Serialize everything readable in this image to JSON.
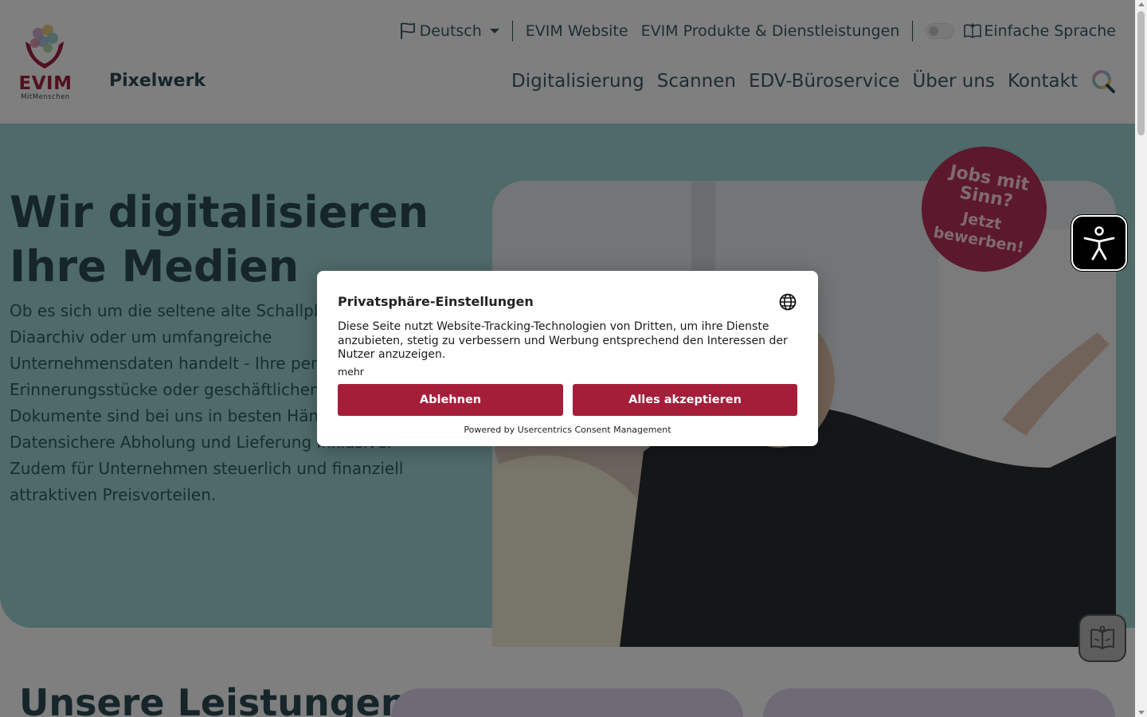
{
  "header": {
    "logo_text": "EVIM",
    "logo_subtext": "MitMenschen",
    "site_name": "Pixelwerk",
    "language": "Deutsch",
    "top_links": [
      "EVIM Website",
      "EVIM Produkte & Dienstleistungen"
    ],
    "easy_language": "Einfache Sprache",
    "nav": [
      "Digitalisierung",
      "Scannen",
      "EDV-Büroservice",
      "Über uns",
      "Kontakt"
    ]
  },
  "hero": {
    "title_line1": "Wir digitalisieren",
    "title_line2": "Ihre Medien",
    "text": "Ob es sich um die seltene alte Schallplatte, das Diaarchiv oder um umfangreiche Unternehmensdaten handelt - Ihre persönlichen Erinnerungsstücke oder geschäftlichen Dokumente sind bei uns in besten Händen. Datensichere Abholung und Lieferung inklusive. Zudem für Unternehmen steuerlich und finanziell attraktiven Preisvorteilen.",
    "badge_line1": "Jobs mit Sinn?",
    "badge_line2": "Jetzt bewerben!"
  },
  "services": {
    "title": "Unsere Leistungen"
  },
  "consent": {
    "title": "Privatsphäre-Einstellungen",
    "text": "Diese Seite nutzt Website-Tracking-Technologien von Dritten, um ihre Dienste anzubieten, stetig zu verbessern und Werbung entsprechend den Interessen der Nutzer anzuzeigen.",
    "more": "mehr",
    "deny_label": "Ablehnen",
    "accept_label": "Alles akzeptieren",
    "powered_by": "Powered by Usercentrics Consent Management"
  },
  "icons": {
    "language": "flag-icon",
    "easy_language": "book-icon",
    "search": "search-icon",
    "consent_language": "globe-icon",
    "accessibility": "accessibility-icon",
    "reader": "reader-icon"
  },
  "colors": {
    "brand_red": "#a41e3a",
    "hero_bg": "#9dd4d3",
    "badge": "#b8305a",
    "text_dark": "#2c4a52"
  }
}
